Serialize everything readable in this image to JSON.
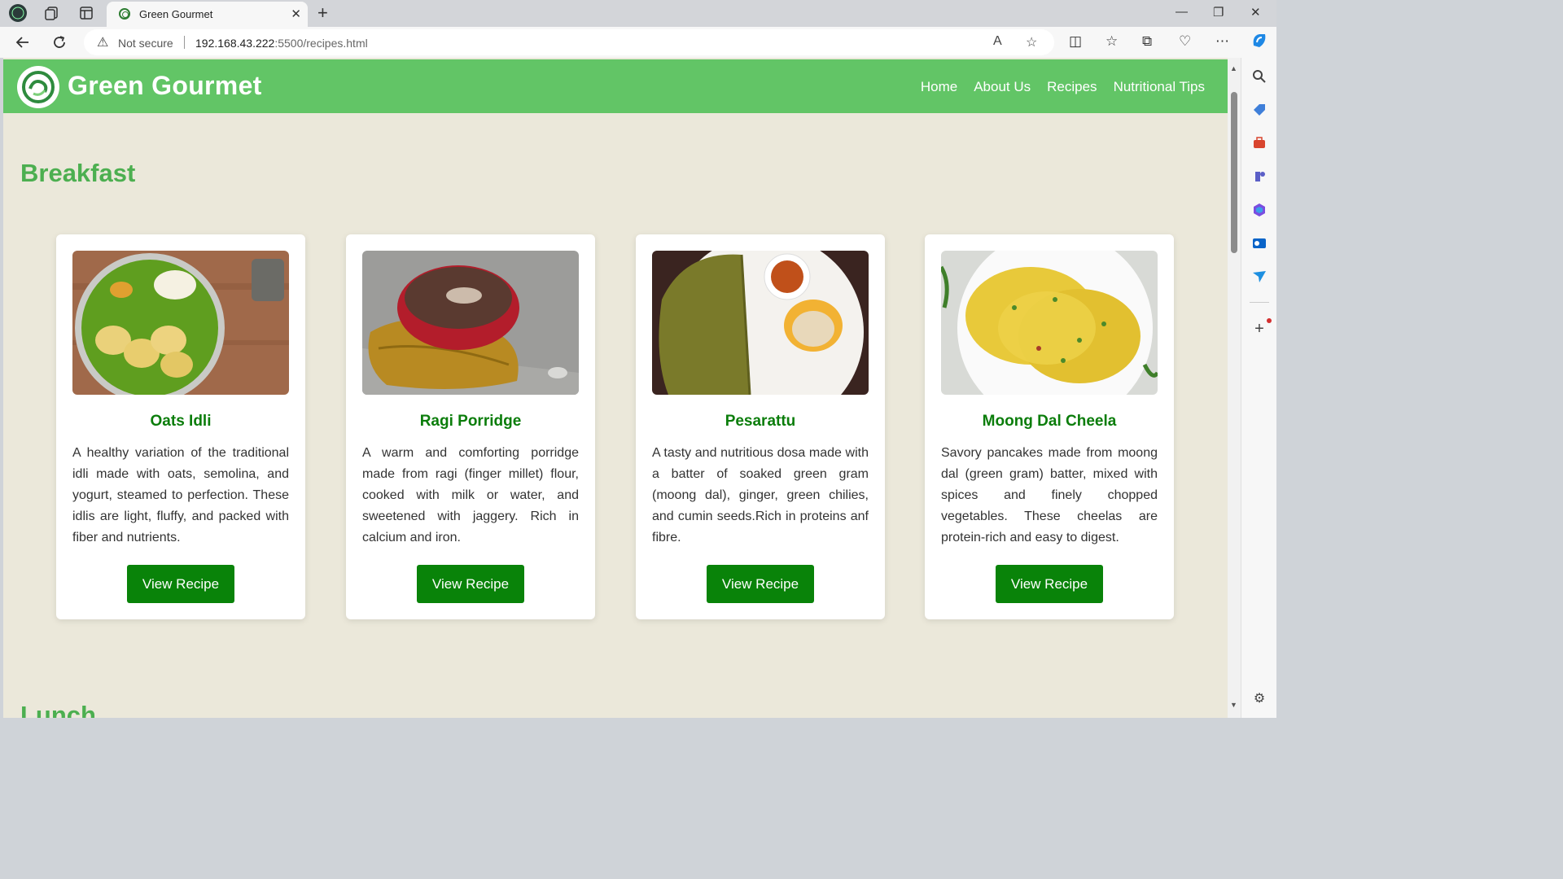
{
  "browser": {
    "tab_title": "Green Gourmet",
    "security_label": "Not secure",
    "url_host": "192.168.43.222",
    "url_rest": ":5500/recipes.html"
  },
  "site": {
    "name": "Green Gourmet",
    "nav": [
      "Home",
      "About Us",
      "Recipes",
      "Nutritional Tips"
    ]
  },
  "sections": [
    {
      "title": "Breakfast",
      "cards": [
        {
          "title": "Oats Idli",
          "description": "A healthy variation of the traditional idli made with oats, semolina, and yogurt, steamed to perfection. These idlis are light, fluffy, and packed with fiber and nutrients.",
          "button": "View Recipe"
        },
        {
          "title": "Ragi Porridge",
          "description": "A warm and comforting porridge made from ragi (finger millet) flour, cooked with milk or water, and sweetened with jaggery. Rich in calcium and iron.",
          "button": "View Recipe"
        },
        {
          "title": "Pesarattu",
          "description": "A tasty and nutritious dosa made with a batter of soaked green gram (moong dal), ginger, green chilies, and cumin seeds.Rich in proteins anf fibre.",
          "button": "View Recipe"
        },
        {
          "title": "Moong Dal Cheela",
          "description": "Savory pancakes made from moong dal (green gram) batter, mixed with spices and finely chopped vegetables. These cheelas are protein-rich and easy to digest.",
          "button": "View Recipe"
        }
      ]
    },
    {
      "title": "Lunch"
    }
  ],
  "colors": {
    "header_green": "#62c566",
    "page_bg": "#ebe8da",
    "title_green": "#4caf50",
    "button_green": "#098309",
    "card_title_green": "#0b7d0b"
  }
}
